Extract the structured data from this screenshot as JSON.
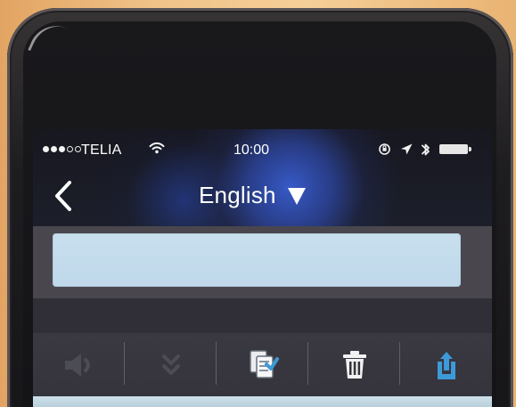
{
  "status_bar": {
    "carrier": "TELIA",
    "time": "10:00",
    "signal_strength": 3,
    "signal_slots": 5,
    "battery_level": 1.0
  },
  "nav": {
    "title": "English",
    "back_icon": "chevron-left-icon",
    "dropdown_icon": "triangle-down-icon"
  },
  "input": {
    "value": "",
    "placeholder": ""
  },
  "toolbar": {
    "buttons": [
      {
        "icon": "speaker-icon"
      },
      {
        "icon": "double-chevron-down-icon"
      },
      {
        "icon": "copy-check-icon"
      },
      {
        "icon": "trash-icon"
      },
      {
        "icon": "share-icon"
      }
    ]
  },
  "colors": {
    "input_background": "#c7dfee",
    "accent": "#3d9ad8",
    "toolbar_icon": "#4c4c54"
  }
}
